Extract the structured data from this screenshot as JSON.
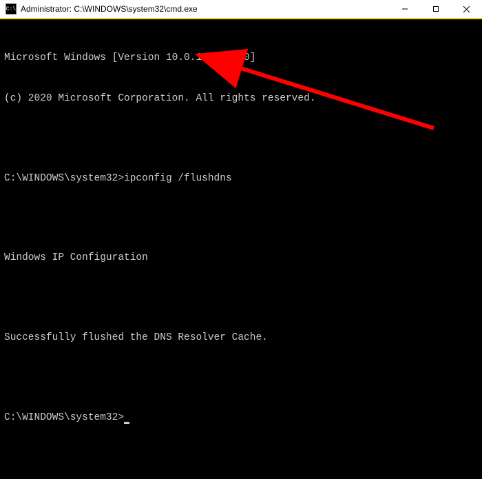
{
  "window": {
    "title": "Administrator: C:\\WINDOWS\\system32\\cmd.exe",
    "icon_label": "C:\\"
  },
  "terminal": {
    "version_line": "Microsoft Windows [Version 10.0.19042.870]",
    "copyright_line": "(c) 2020 Microsoft Corporation. All rights reserved.",
    "prompt1": "C:\\WINDOWS\\system32>",
    "command1": "ipconfig /flushdns",
    "output_header": "Windows IP Configuration",
    "output_result": "Successfully flushed the DNS Resolver Cache.",
    "prompt2": "C:\\WINDOWS\\system32>"
  },
  "annotation": {
    "arrow_color": "#ff0000"
  }
}
